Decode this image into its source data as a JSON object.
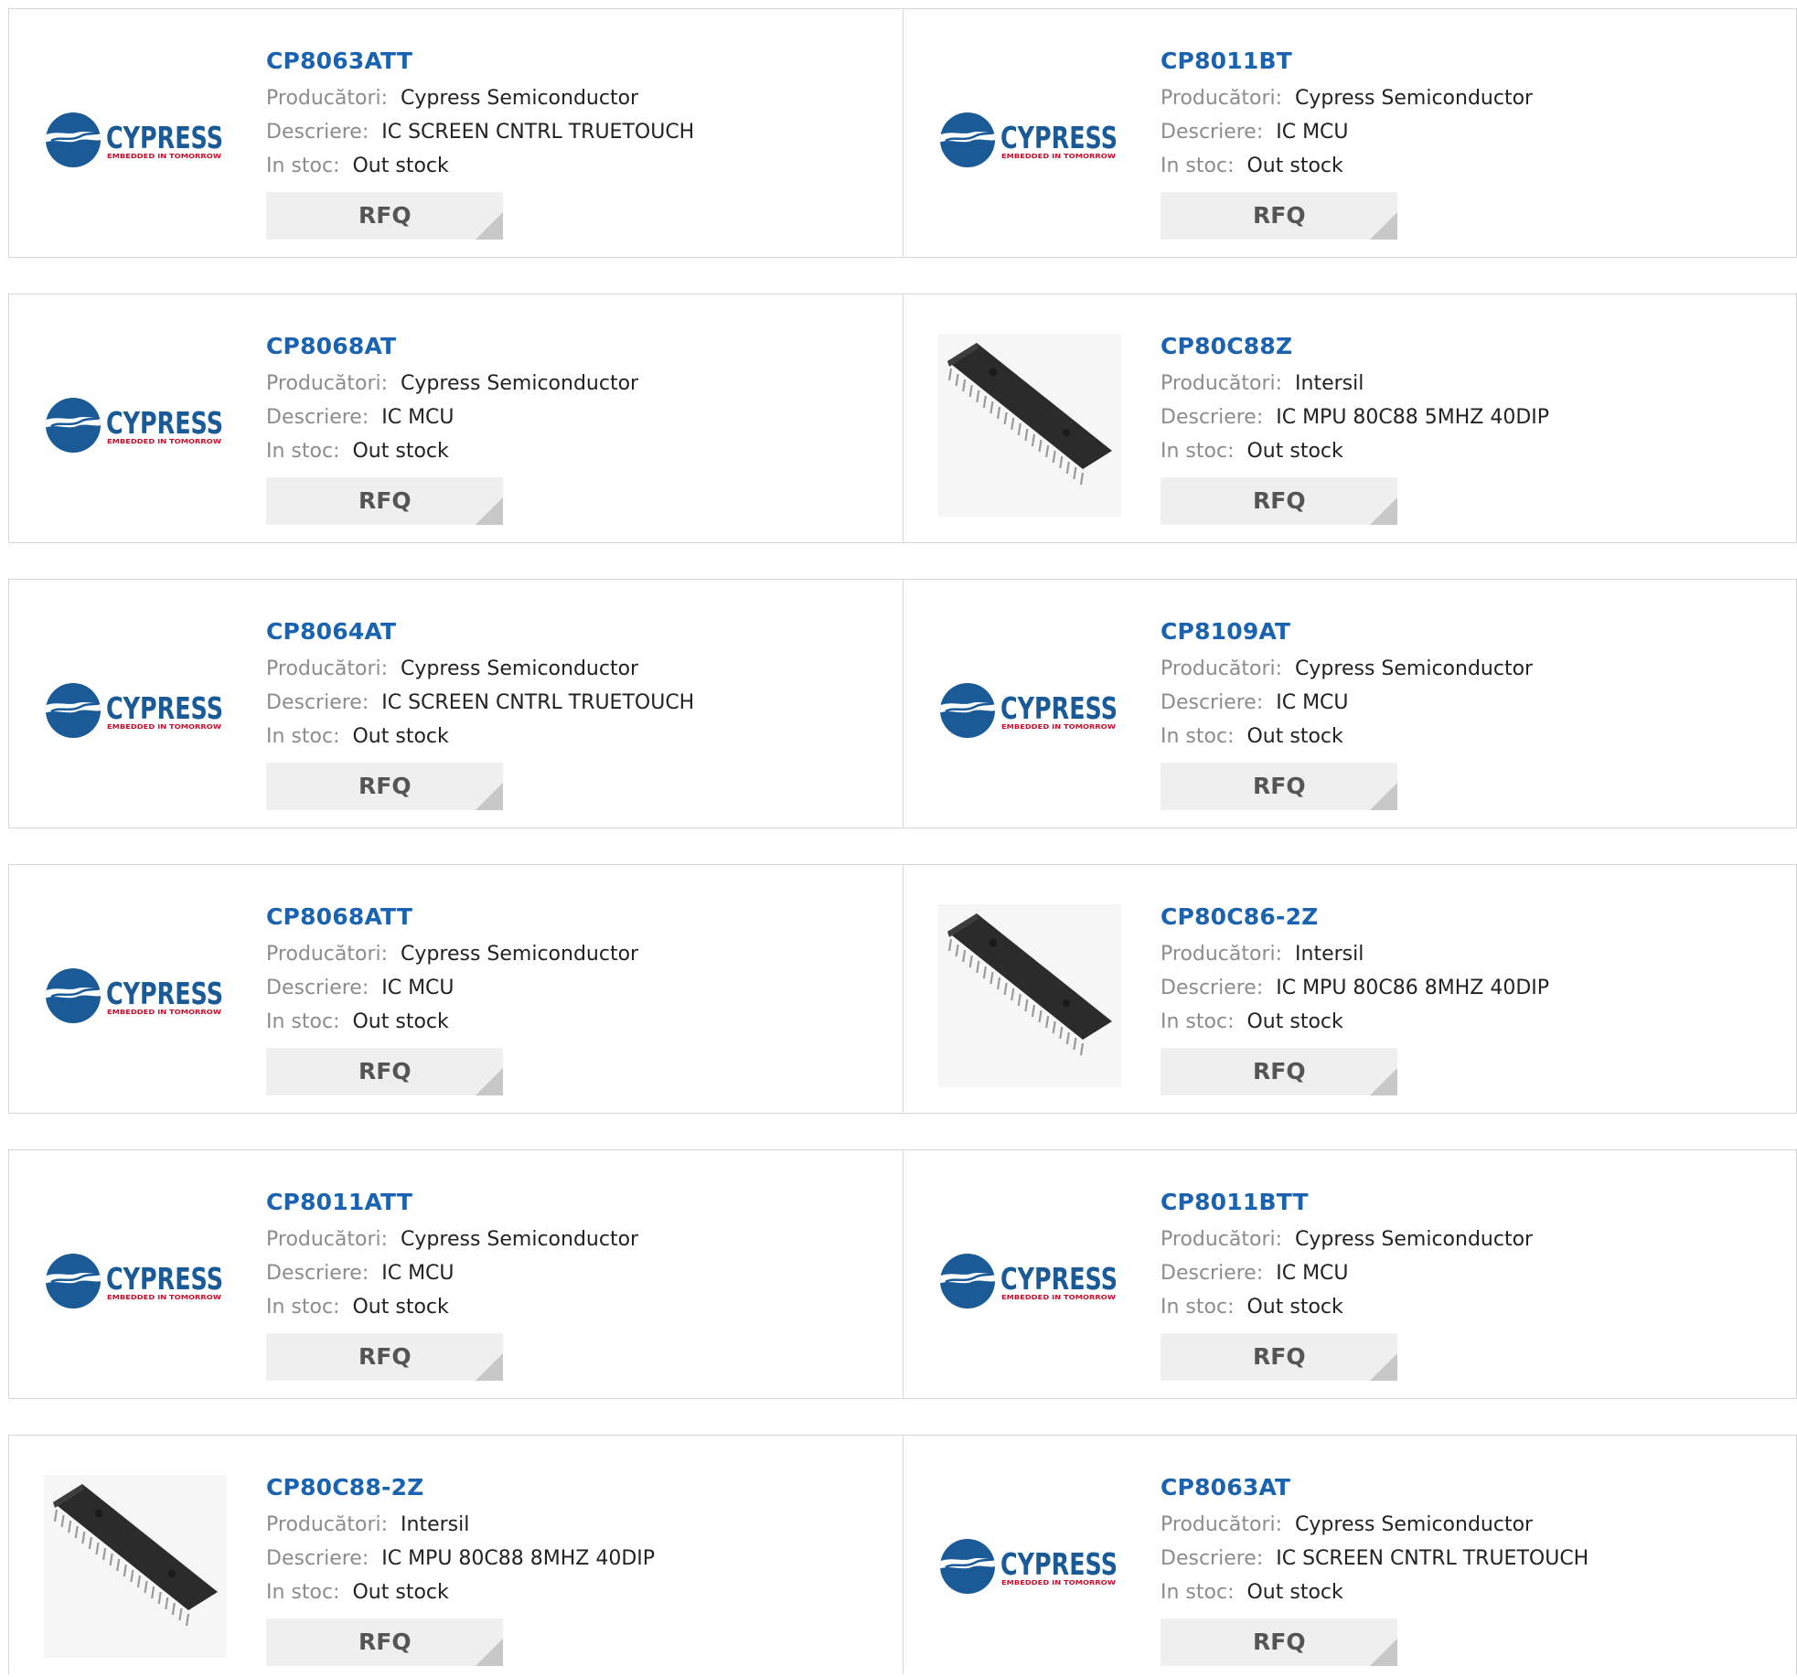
{
  "labels": {
    "manufacturer": "Producători:",
    "description": "Descriere:",
    "stock": "In stoc:",
    "rfq": "RFQ"
  },
  "logo_text": {
    "brand": "CYPRESS",
    "tagline": "EMBEDDED IN TOMORROW"
  },
  "colors": {
    "title_link": "#1a63b0",
    "border": "#d6d6d6",
    "rfq_bg": "#efefef",
    "label": "#8c8c8c",
    "cypress_blue": "#1a5a96",
    "cypress_red": "#c8102e"
  },
  "products": [
    {
      "part": "CP8063ATT",
      "manufacturer": "Cypress Semiconductor",
      "description": "IC SCREEN CNTRL TRUETOUCH",
      "stock": "Out stock",
      "image": "cypress-logo"
    },
    {
      "part": "CP8011BT",
      "manufacturer": "Cypress Semiconductor",
      "description": "IC MCU",
      "stock": "Out stock",
      "image": "cypress-logo"
    },
    {
      "part": "CP8068AT",
      "manufacturer": "Cypress Semiconductor",
      "description": "IC MCU",
      "stock": "Out stock",
      "image": "cypress-logo"
    },
    {
      "part": "CP80C88Z",
      "manufacturer": "Intersil",
      "description": "IC MPU 80C88 5MHZ 40DIP",
      "stock": "Out stock",
      "image": "dip-chip"
    },
    {
      "part": "CP8064AT",
      "manufacturer": "Cypress Semiconductor",
      "description": "IC SCREEN CNTRL TRUETOUCH",
      "stock": "Out stock",
      "image": "cypress-logo"
    },
    {
      "part": "CP8109AT",
      "manufacturer": "Cypress Semiconductor",
      "description": "IC MCU",
      "stock": "Out stock",
      "image": "cypress-logo"
    },
    {
      "part": "CP8068ATT",
      "manufacturer": "Cypress Semiconductor",
      "description": "IC MCU",
      "stock": "Out stock",
      "image": "cypress-logo"
    },
    {
      "part": "CP80C86-2Z",
      "manufacturer": "Intersil",
      "description": "IC MPU 80C86 8MHZ 40DIP",
      "stock": "Out stock",
      "image": "dip-chip"
    },
    {
      "part": "CP8011ATT",
      "manufacturer": "Cypress Semiconductor",
      "description": "IC MCU",
      "stock": "Out stock",
      "image": "cypress-logo"
    },
    {
      "part": "CP8011BTT",
      "manufacturer": "Cypress Semiconductor",
      "description": "IC MCU",
      "stock": "Out stock",
      "image": "cypress-logo"
    },
    {
      "part": "CP80C88-2Z",
      "manufacturer": "Intersil",
      "description": "IC MPU 80C88 8MHZ 40DIP",
      "stock": "Out stock",
      "image": "dip-chip"
    },
    {
      "part": "CP8063AT",
      "manufacturer": "Cypress Semiconductor",
      "description": "IC SCREEN CNTRL TRUETOUCH",
      "stock": "Out stock",
      "image": "cypress-logo"
    }
  ]
}
